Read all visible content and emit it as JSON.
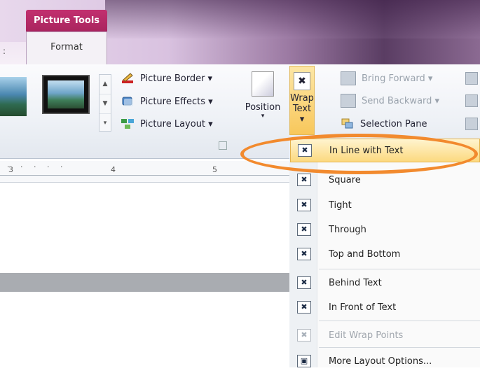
{
  "contextual_tab": {
    "group_label": "Picture Tools",
    "tab_label": "Format",
    "left_stub": ":"
  },
  "ribbon": {
    "picture_styles": {
      "picture_border": "Picture Border ▾",
      "picture_effects": "Picture Effects ▾",
      "picture_layout": "Picture Layout ▾"
    },
    "position_label": "Position",
    "wrap_text": {
      "line1": "Wrap",
      "line2": "Text ▾"
    },
    "arrange": {
      "bring_forward": "Bring Forward ▾",
      "send_backward": "Send Backward ▾",
      "selection_pane": "Selection Pane"
    }
  },
  "ruler": {
    "marks": [
      "3",
      "4",
      "5"
    ]
  },
  "wrap_menu": {
    "items": [
      {
        "label": "In Line with Text",
        "state": "highlighted"
      },
      {
        "label": "Square",
        "state": "normal"
      },
      {
        "label": "Tight",
        "state": "normal"
      },
      {
        "label": "Through",
        "state": "normal"
      },
      {
        "label": "Top and Bottom",
        "state": "normal"
      },
      {
        "label": "Behind Text",
        "state": "normal"
      },
      {
        "label": "In Front of Text",
        "state": "normal"
      },
      {
        "label": "Edit Wrap Points",
        "state": "disabled"
      },
      {
        "label": "More Layout Options...",
        "state": "normal"
      }
    ]
  },
  "colors": {
    "context_tab": "#b82866",
    "highlight": "#fcd97f",
    "annotation_oval": "#f28a2e"
  }
}
